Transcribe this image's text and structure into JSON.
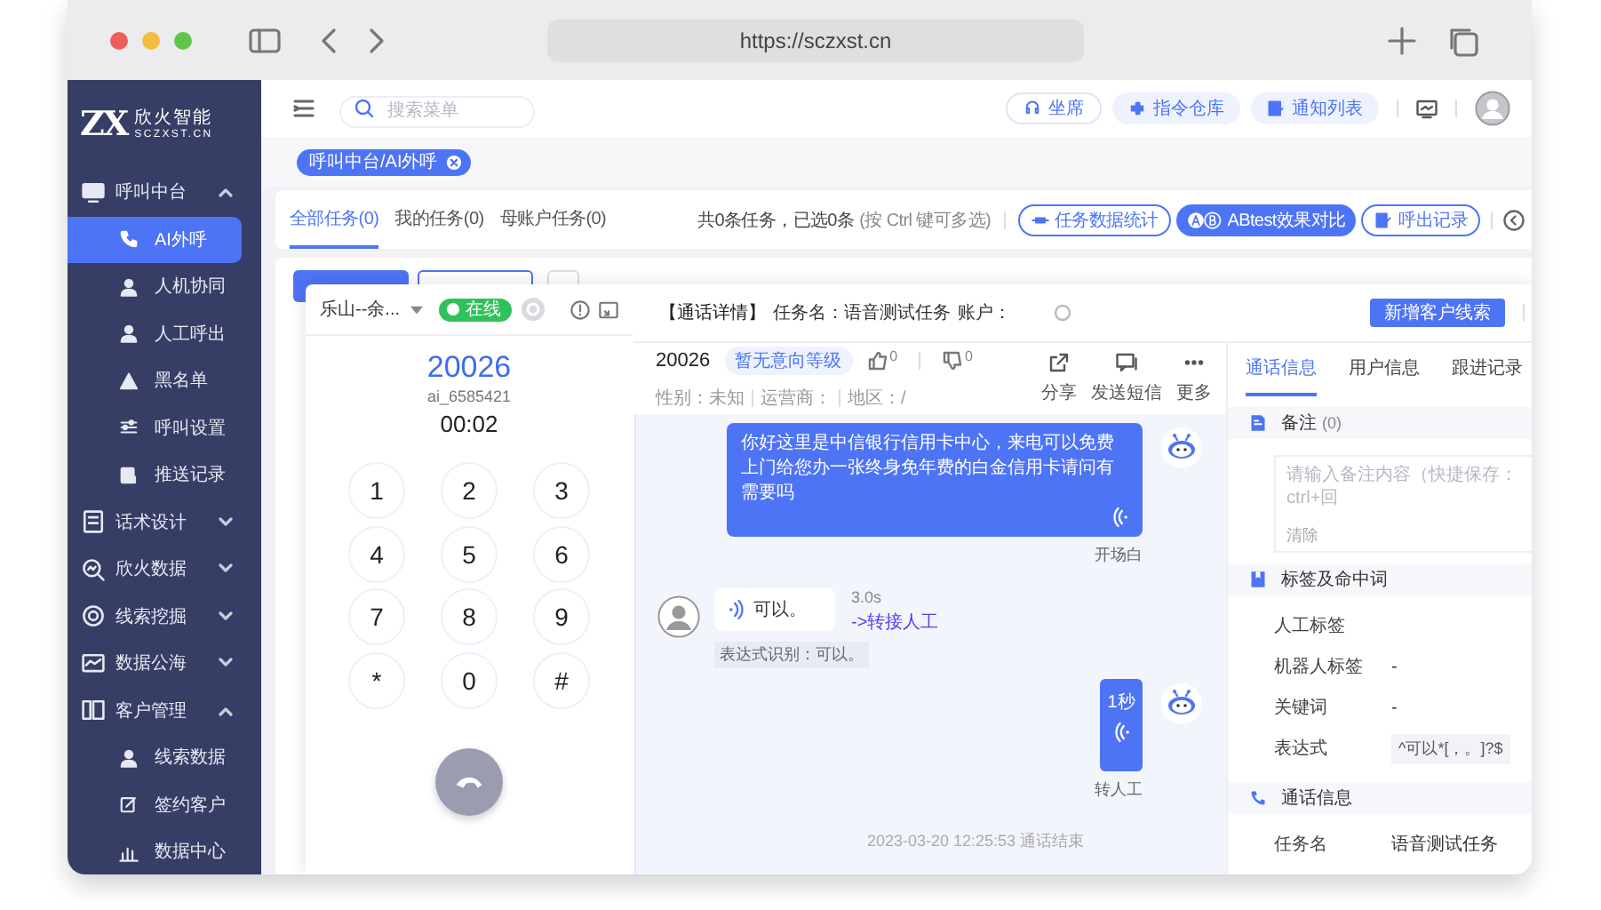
{
  "browser": {
    "url": "https://sczxst.cn"
  },
  "brand": {
    "mark": "ZX",
    "name": "欣火智能",
    "domain": "SCZXST.CN"
  },
  "sidebar": {
    "items": [
      {
        "label": "呼叫中台",
        "expanded": true,
        "selected": false,
        "children": [
          {
            "label": "AI外呼",
            "selected": true
          },
          {
            "label": "人机协同",
            "selected": false
          },
          {
            "label": "人工呼出",
            "selected": false
          },
          {
            "label": "黑名单",
            "selected": false
          },
          {
            "label": "呼叫设置",
            "selected": false
          },
          {
            "label": "推送记录",
            "selected": false
          }
        ]
      },
      {
        "label": "话术设计",
        "expanded": false,
        "selected": false
      },
      {
        "label": "欣火数据",
        "expanded": false,
        "selected": false
      },
      {
        "label": "线索挖掘",
        "expanded": false,
        "selected": false
      },
      {
        "label": "数据公海",
        "expanded": false,
        "selected": false
      },
      {
        "label": "客户管理",
        "expanded": true,
        "selected": false,
        "children": [
          {
            "label": "线索数据",
            "selected": false
          },
          {
            "label": "签约客户",
            "selected": false
          },
          {
            "label": "数据中心",
            "selected": false
          }
        ]
      }
    ]
  },
  "topbar": {
    "search": {
      "placeholder": "搜索菜单"
    },
    "buttons": [
      {
        "label": "坐席",
        "kind": "outline"
      },
      {
        "label": "指令仓库",
        "kind": "soft"
      },
      {
        "label": "通知列表",
        "kind": "soft"
      }
    ]
  },
  "tag_bar": {
    "tags": [
      {
        "label": "呼叫中台/AI外呼",
        "selected": true
      }
    ]
  },
  "tasks": {
    "tabs": [
      {
        "label": "全部任务(0)",
        "selected": true
      },
      {
        "label": "我的任务(0)",
        "selected": false
      },
      {
        "label": "母账户任务(0)",
        "selected": false
      }
    ],
    "summary": "共0条任务，已选0条",
    "hint": "(按 Ctrl 键可多选)",
    "buttons": [
      {
        "label": "任务数据统计",
        "kind": "outline"
      },
      {
        "label": "ABtest效果对比",
        "kind": "primary"
      },
      {
        "label": "呼出记录",
        "kind": "outline"
      }
    ]
  },
  "dialer": {
    "line": "乐山--余...",
    "status": "在线",
    "online": true,
    "number": "20026",
    "account": "ai_6585421",
    "duration": "00:02",
    "keys": [
      "1",
      "2",
      "3",
      "4",
      "5",
      "6",
      "7",
      "8",
      "9",
      "*",
      "0",
      "#"
    ]
  },
  "call_detail": {
    "title": "【通话详情】",
    "task": "任务名：语音测试任务",
    "account": "账户：",
    "add_button": "新增客户线索",
    "caller": {
      "number": "20026",
      "intent": "暂无意向等级",
      "likes": "0",
      "dislikes": "0",
      "gender": "性别：未知",
      "carrier": "运营商：",
      "region": "地区：/"
    },
    "actions": [
      {
        "label": "分享"
      },
      {
        "label": "发送短信"
      },
      {
        "label": "更多"
      }
    ],
    "messages": [
      {
        "kind": "bot",
        "text": "你好这里是中信银行信用卡中心，来电可以免费上门给您办一张终身免年费的白金信用卡请问有需要吗",
        "caption": "开场白"
      },
      {
        "kind": "user",
        "text": "可以。",
        "duration": "3.0s",
        "action": "->转接人工",
        "recognition": "表达式识别：可以。"
      },
      {
        "kind": "bot_audio",
        "text": "1秒",
        "caption": "转人工"
      }
    ],
    "end_note": "2023-03-20 12:25:53 通话结束"
  },
  "info_panel": {
    "tabs": [
      {
        "label": "通话信息",
        "selected": true
      },
      {
        "label": "用户信息",
        "selected": false
      },
      {
        "label": "跟进记录",
        "selected": false
      }
    ],
    "sections": [
      {
        "kind": "note",
        "title": "备注",
        "count": "(0)",
        "placeholder": "请输入备注内容（快捷保存：ctrl+回",
        "clear": "清除"
      },
      {
        "kind": "fields",
        "title": "标签及命中词",
        "rows": [
          {
            "label": "人工标签",
            "kind": "text"
          },
          {
            "label": "机器人标签",
            "value": "-",
            "kind": "text"
          },
          {
            "label": "关键词",
            "value": "-",
            "kind": "text"
          },
          {
            "label": "表达式",
            "value": "^可以*[，。]?$",
            "kind": "code"
          }
        ]
      },
      {
        "kind": "call",
        "title": "通话信息",
        "rows": [
          {
            "label": "任务名",
            "value": "语音测试任务",
            "kind": "text"
          }
        ]
      }
    ]
  }
}
